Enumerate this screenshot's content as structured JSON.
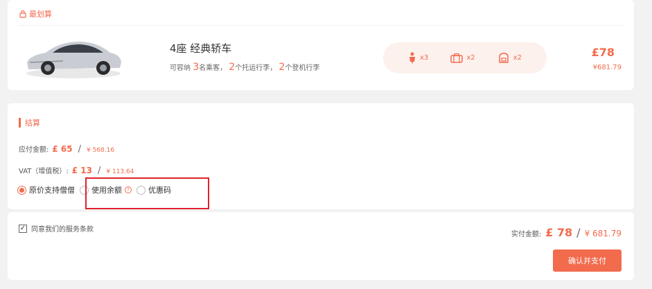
{
  "best": {
    "label": "最划算"
  },
  "car": {
    "title": "4座 经典轿车",
    "cap_prefix": "可容纳",
    "passengers": "3",
    "passengers_unit": "名乘客，",
    "checked": "2",
    "checked_unit": "个托运行李，",
    "carry": "2",
    "carry_unit": "个登机行李",
    "features": [
      {
        "icon": "passenger-icon",
        "count": "x3"
      },
      {
        "icon": "suitcase-icon",
        "count": "x2"
      },
      {
        "icon": "backpack-icon",
        "count": "x2"
      }
    ],
    "price_gbp": "£78",
    "price_cny": "¥681.79"
  },
  "settle": {
    "title": "结算",
    "due_label": "应付金额:",
    "due_gbp": "£ 65",
    "due_cny": "¥ 568.16",
    "vat_label": "VAT（增值税）:",
    "vat_gbp": "£ 13",
    "vat_cny": "¥ 113.64",
    "options": {
      "original": "原价支持僧僧",
      "balance": "使用余额",
      "coupon": "优惠码"
    }
  },
  "footer": {
    "agree_label": "同意我们的服务条款",
    "paid_label": "实付金额:",
    "paid_gbp": "£ 78",
    "slash": "/",
    "paid_cny": "¥ 681.79",
    "confirm_button": "确认并支付"
  },
  "colors": {
    "accent": "#f26b4d",
    "highlight": "#e0212b"
  }
}
